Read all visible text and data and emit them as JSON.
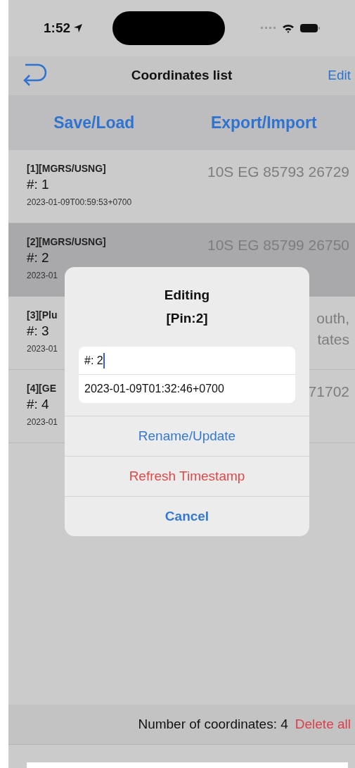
{
  "status_bar": {
    "time": "1:52"
  },
  "nav": {
    "title": "Coordinates list",
    "edit": "Edit"
  },
  "toolbar": {
    "buttons": [
      "Save/Load",
      "Export/Import"
    ]
  },
  "rows": [
    {
      "label": "[1][MGRS/USNG]",
      "name": "#: 1",
      "timestamp": "2023-01-09T00:59:53+0700",
      "value_lines": [
        "10S EG 85793 26729"
      ],
      "selected": false
    },
    {
      "label": "[2][MGRS/USNG]",
      "name": "#: 2",
      "timestamp": "2023-01",
      "value_lines": [
        "10S EG 85799 26750"
      ],
      "selected": true
    },
    {
      "label": "[3][Plu",
      "name": "#: 3",
      "timestamp": "2023-01",
      "value_lines": [
        "outh,",
        "tates"
      ],
      "selected": false
    },
    {
      "label": "[4][GE",
      "name": "#: 4",
      "timestamp": "2023-01",
      "value_lines": [
        "71702"
      ],
      "selected": false
    }
  ],
  "dialog": {
    "title": "Editing",
    "subtitle": "[Pin:2]",
    "name_value": "#: 2",
    "timestamp_value": "2023-01-09T01:32:46+0700",
    "actions": [
      {
        "label": "Rename/Update",
        "kind": "default"
      },
      {
        "label": "Refresh Timestamp",
        "kind": "destructive"
      },
      {
        "label": "Cancel",
        "kind": "cancel"
      }
    ]
  },
  "footer": {
    "count": "Number of coordinates: 4",
    "delete": "Delete all"
  }
}
